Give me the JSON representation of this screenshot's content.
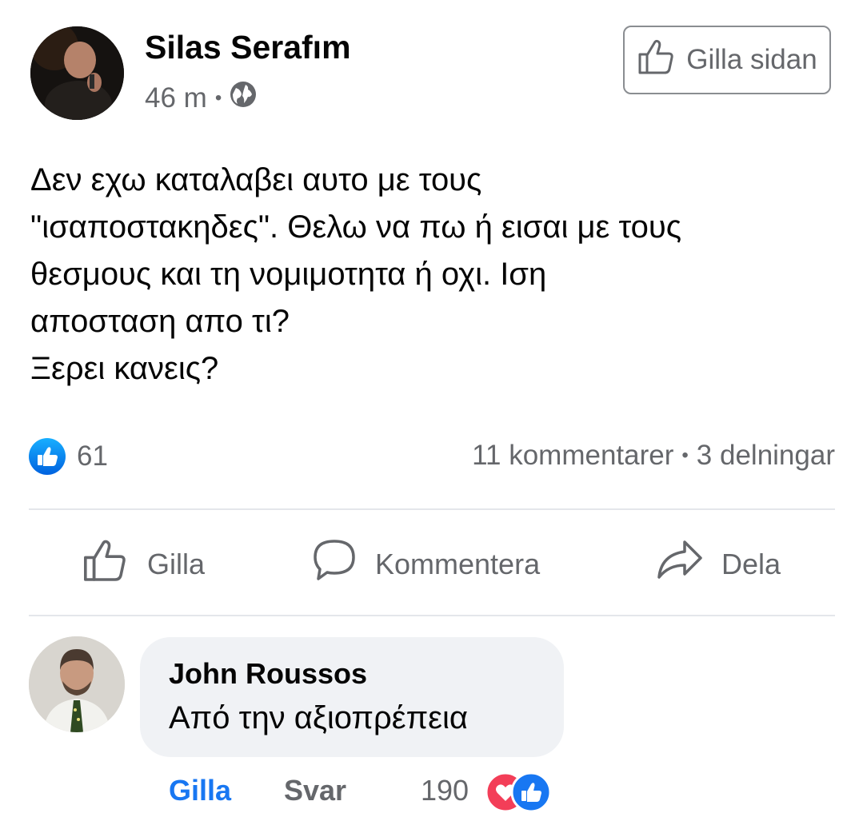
{
  "post": {
    "author": "Silas Serafım",
    "time": "46 m",
    "separator": "•",
    "privacy_icon": "globe-icon",
    "like_page_label": "Gilla sidan",
    "body_lines": [
      "Δεν εχω καταλαβει αυτο με τους",
      "\"ισαποστακηδες\". Θελω να πω ή εισαι με τους",
      "θεσμους και τη νομιμοτητα ή οχι. Ιση",
      "αποσταση απο τι?",
      "Ξερει κανεις?"
    ],
    "reaction_count": "61",
    "comments_count": "11 kommentarer",
    "shares_count": "3 delningar"
  },
  "actions": {
    "like": "Gilla",
    "comment": "Kommentera",
    "share": "Dela"
  },
  "comment": {
    "author": "John Roussos",
    "text": "Από την αξιοπρέπεια",
    "like": "Gilla",
    "reply": "Svar",
    "reaction_count": "190"
  },
  "colors": {
    "accent": "#1877f2",
    "secondary_text": "#65676b",
    "bubble": "#f0f2f5",
    "love": "#f33e58"
  }
}
